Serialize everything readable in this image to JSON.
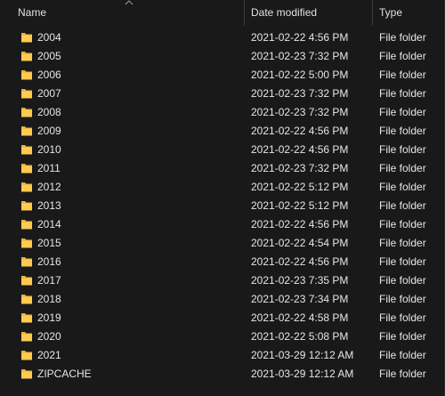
{
  "columns": {
    "name": "Name",
    "date_modified": "Date modified",
    "type": "Type"
  },
  "sort": {
    "column": "name",
    "direction": "ascending",
    "icon": "chevron-up-icon"
  },
  "colors": {
    "folder": "#ffca4f",
    "folder_tab": "#e8b13a",
    "background": "#191919",
    "text": "#e6e6e6"
  },
  "rows": [
    {
      "name": "2004",
      "date": "2021-02-22 4:56 PM",
      "type": "File folder"
    },
    {
      "name": "2005",
      "date": "2021-02-23 7:32 PM",
      "type": "File folder"
    },
    {
      "name": "2006",
      "date": "2021-02-22 5:00 PM",
      "type": "File folder"
    },
    {
      "name": "2007",
      "date": "2021-02-23 7:32 PM",
      "type": "File folder"
    },
    {
      "name": "2008",
      "date": "2021-02-23 7:32 PM",
      "type": "File folder"
    },
    {
      "name": "2009",
      "date": "2021-02-22 4:56 PM",
      "type": "File folder"
    },
    {
      "name": "2010",
      "date": "2021-02-22 4:56 PM",
      "type": "File folder"
    },
    {
      "name": "2011",
      "date": "2021-02-23 7:32 PM",
      "type": "File folder"
    },
    {
      "name": "2012",
      "date": "2021-02-22 5:12 PM",
      "type": "File folder"
    },
    {
      "name": "2013",
      "date": "2021-02-22 5:12 PM",
      "type": "File folder"
    },
    {
      "name": "2014",
      "date": "2021-02-22 4:56 PM",
      "type": "File folder"
    },
    {
      "name": "2015",
      "date": "2021-02-22 4:54 PM",
      "type": "File folder"
    },
    {
      "name": "2016",
      "date": "2021-02-22 4:56 PM",
      "type": "File folder"
    },
    {
      "name": "2017",
      "date": "2021-02-23 7:35 PM",
      "type": "File folder"
    },
    {
      "name": "2018",
      "date": "2021-02-23 7:34 PM",
      "type": "File folder"
    },
    {
      "name": "2019",
      "date": "2021-02-22 4:58 PM",
      "type": "File folder"
    },
    {
      "name": "2020",
      "date": "2021-02-22 5:08 PM",
      "type": "File folder"
    },
    {
      "name": "2021",
      "date": "2021-03-29 12:12 AM",
      "type": "File folder"
    },
    {
      "name": "ZIPCACHE",
      "date": "2021-03-29 12:12 AM",
      "type": "File folder"
    }
  ]
}
